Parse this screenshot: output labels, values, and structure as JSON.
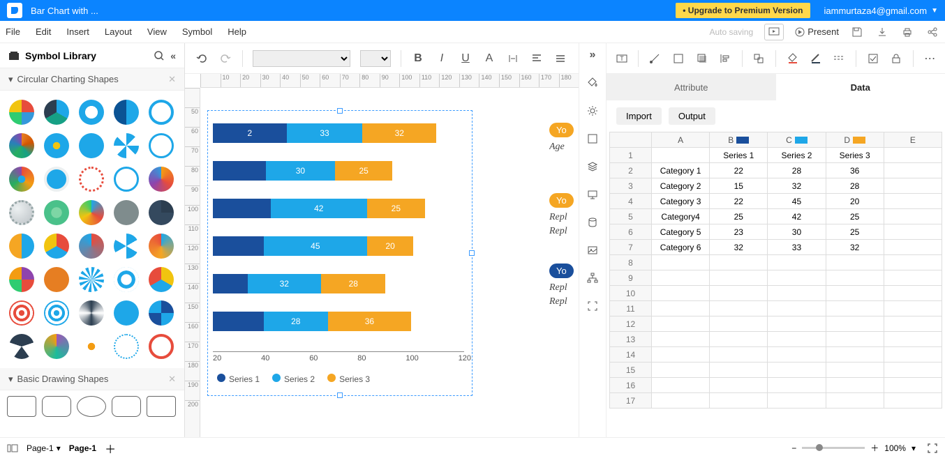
{
  "titlebar": {
    "title": "Bar Chart with ...",
    "upgrade": "• Upgrade to Premium Version",
    "user": "iammurtaza4@gmail.com"
  },
  "menu": {
    "items": [
      "File",
      "Edit",
      "Insert",
      "Layout",
      "View",
      "Symbol",
      "Help"
    ],
    "autosaving": "Auto saving",
    "present": "Present"
  },
  "lib": {
    "title": "Symbol Library",
    "cats": [
      "Circular Charting Shapes",
      "Basic Drawing Shapes"
    ]
  },
  "tabs": {
    "attribute": "Attribute",
    "data": "Data"
  },
  "data_actions": {
    "import": "Import",
    "output": "Output"
  },
  "ruler_h": [
    "",
    "10",
    "20",
    "30",
    "40",
    "50",
    "60",
    "70",
    "80",
    "90",
    "100",
    "110",
    "120",
    "130",
    "140",
    "150",
    "160",
    "170",
    "180"
  ],
  "ruler_v": [
    "",
    "50",
    "60",
    "70",
    "80",
    "90",
    "100",
    "110",
    "120",
    "130",
    "140",
    "150",
    "160",
    "170",
    "180",
    "190",
    "200"
  ],
  "side": {
    "pill1": "Yo",
    "txt1": "Age",
    "pill2": "Yo",
    "txt2": "Repl",
    "txt3": "Repl",
    "pill3": "Yo",
    "txt4": "Repl",
    "txt5": "Repl"
  },
  "chart_data": {
    "type": "bar",
    "orientation": "horizontal-stacked",
    "categories": [
      "Category 1",
      "Category 2",
      "Category 3",
      "Category4",
      "Category 5",
      "Category 6"
    ],
    "series": [
      {
        "name": "Series 1",
        "color": "#1a4f9c",
        "values": [
          22,
          15,
          22,
          25,
          23,
          32
        ]
      },
      {
        "name": "Series 2",
        "color": "#1ea7e8",
        "values": [
          28,
          32,
          45,
          42,
          30,
          33
        ]
      },
      {
        "name": "Series 3",
        "color": "#f5a623",
        "values": [
          36,
          28,
          20,
          25,
          25,
          32
        ]
      }
    ],
    "xticks": [
      20,
      40,
      60,
      80,
      100,
      120
    ],
    "shown_labels": [
      [
        "2",
        "33",
        "32"
      ],
      [
        "",
        "30",
        "25"
      ],
      [
        "",
        "42",
        "25"
      ],
      [
        "",
        "45",
        "20"
      ],
      [
        "",
        "32",
        "28"
      ],
      [
        "",
        "28",
        "36"
      ]
    ],
    "legend": [
      "Series 1",
      "Series 2",
      "Series 3"
    ]
  },
  "sheet": {
    "cols": [
      "A",
      "B",
      "C",
      "D",
      "E"
    ],
    "col_colors": {
      "B": "#1a4f9c",
      "C": "#1ea7e8",
      "D": "#f5a623"
    },
    "rows": [
      [
        "",
        "Series 1",
        "Series 2",
        "Series 3",
        ""
      ],
      [
        "Category 1",
        "22",
        "28",
        "36",
        ""
      ],
      [
        "Category 2",
        "15",
        "32",
        "28",
        ""
      ],
      [
        "Category 3",
        "22",
        "45",
        "20",
        ""
      ],
      [
        "Category4",
        "25",
        "42",
        "25",
        ""
      ],
      [
        "Category 5",
        "23",
        "30",
        "25",
        ""
      ],
      [
        "Category 6",
        "32",
        "33",
        "32",
        ""
      ]
    ],
    "empty_rows": 10
  },
  "footer": {
    "page_select": "Page-1",
    "page_tab": "Page-1",
    "zoom": "100%"
  }
}
